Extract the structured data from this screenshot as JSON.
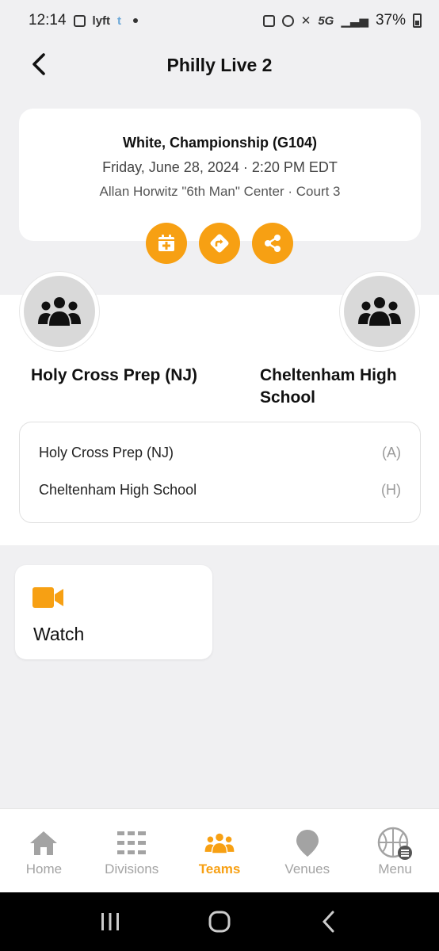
{
  "status_bar": {
    "time": "12:14",
    "network": "5G",
    "battery": "37%"
  },
  "header": {
    "title": "Philly Live 2"
  },
  "game": {
    "name": "White, Championship (G104)",
    "date": "Friday, June 28, 2024 · 2:20 PM EDT",
    "venue": "Allan Horwitz \"6th Man\" Center · Court 3"
  },
  "actions": [
    {
      "icon": "calendar-add-icon"
    },
    {
      "icon": "directions-icon"
    },
    {
      "icon": "share-icon"
    }
  ],
  "teams": {
    "away": {
      "name": "Holy Cross Prep (NJ)",
      "tag": "(A)"
    },
    "home": {
      "name": "Cheltenham High School",
      "tag": "(H)"
    }
  },
  "watch": {
    "label": "Watch",
    "icon": "video-camera-icon"
  },
  "nav": {
    "items": [
      {
        "label": "Home",
        "icon": "home-icon"
      },
      {
        "label": "Divisions",
        "icon": "divisions-icon"
      },
      {
        "label": "Teams",
        "icon": "teams-icon",
        "active": true
      },
      {
        "label": "Venues",
        "icon": "location-pin-icon"
      },
      {
        "label": "Menu",
        "icon": "basketball-menu-icon"
      }
    ]
  },
  "colors": {
    "accent": "#f7a013",
    "background": "#f0f0f2",
    "card": "#ffffff",
    "inactive": "#a3a3a3"
  }
}
